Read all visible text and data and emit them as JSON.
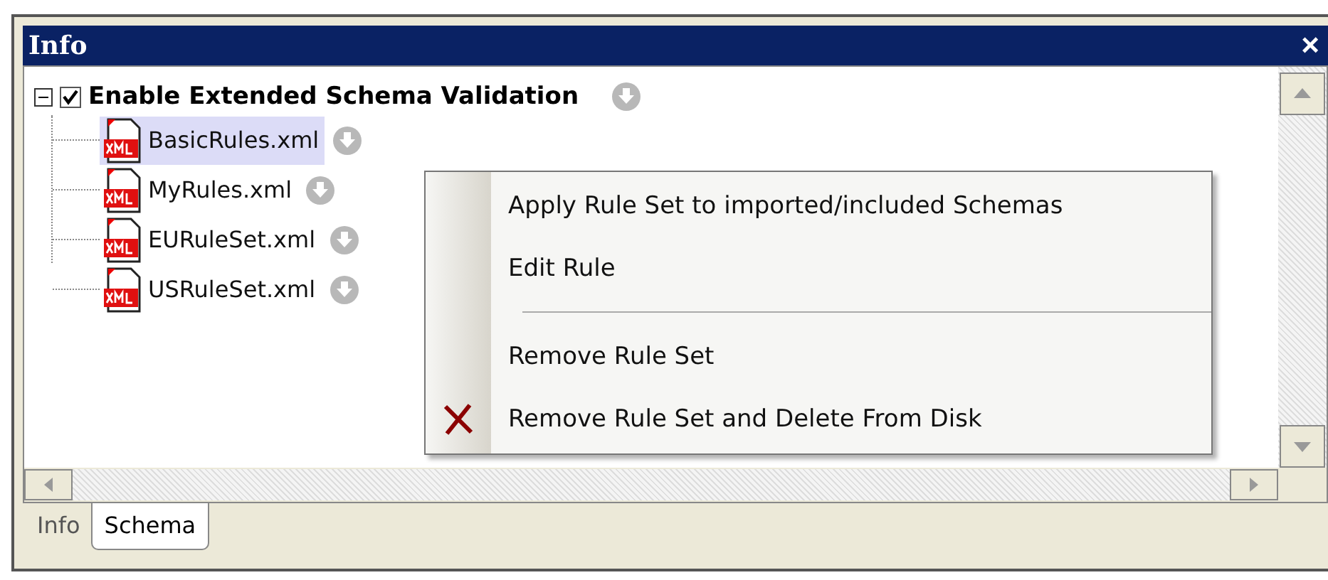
{
  "window": {
    "title": "Info",
    "close": "×"
  },
  "tree": {
    "label": "Enable Extended Schema Validation",
    "expanded": true,
    "checked": true,
    "children": [
      {
        "label": "BasicRules.xml",
        "selected": true
      },
      {
        "label": "MyRules.xml",
        "selected": false
      },
      {
        "label": "EURuleSet.xml",
        "selected": false
      },
      {
        "label": "USRuleSet.xml",
        "selected": false
      }
    ]
  },
  "context_menu": {
    "items": [
      {
        "kind": "item",
        "label": "Apply Rule Set to imported/included Schemas"
      },
      {
        "kind": "item",
        "label": "Edit Rule"
      },
      {
        "kind": "separator"
      },
      {
        "kind": "item",
        "label": "Remove Rule Set"
      },
      {
        "kind": "delete_item",
        "label": "Remove Rule Set and Delete From Disk"
      }
    ]
  },
  "tabs": [
    {
      "label": "Info",
      "selected": false
    },
    {
      "label": "Schema",
      "selected": true
    }
  ]
}
